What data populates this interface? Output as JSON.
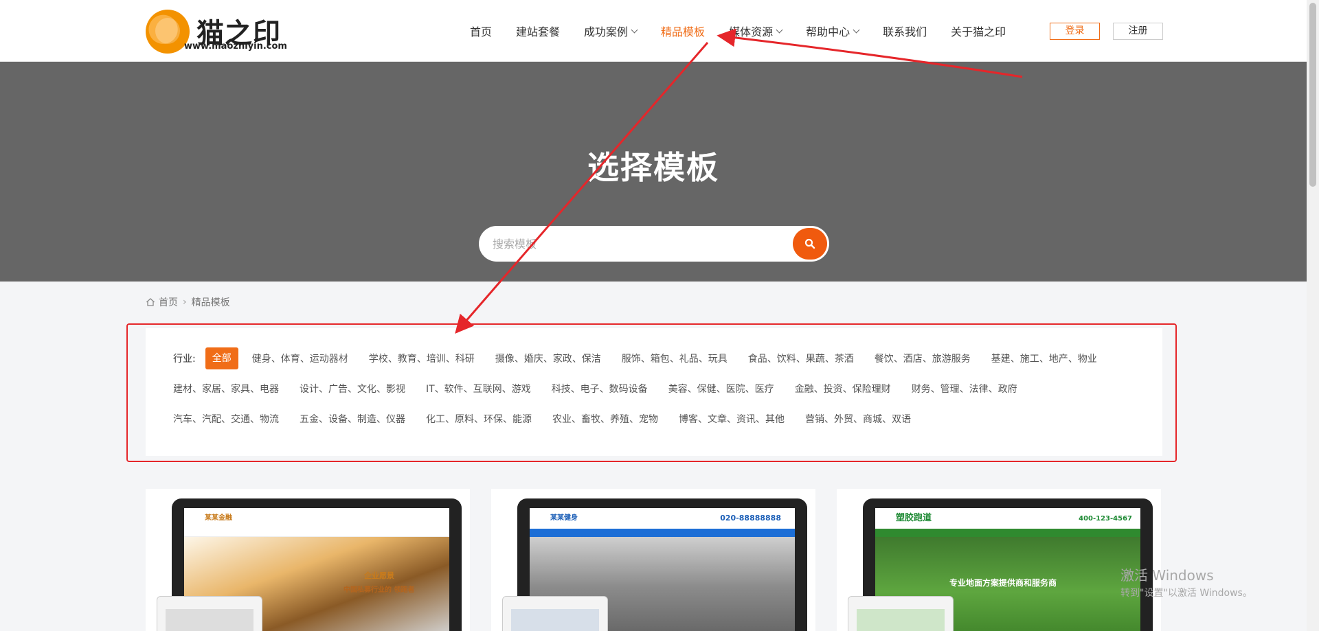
{
  "logo": {
    "name": "猫之印",
    "url": "www.maozhiyin.com"
  },
  "nav": {
    "items": [
      {
        "label": "首页",
        "dropdown": false,
        "active": false
      },
      {
        "label": "建站套餐",
        "dropdown": false,
        "active": false
      },
      {
        "label": "成功案例",
        "dropdown": true,
        "active": false
      },
      {
        "label": "精品模板",
        "dropdown": false,
        "active": true
      },
      {
        "label": "媒体资源",
        "dropdown": true,
        "active": false
      },
      {
        "label": "帮助中心",
        "dropdown": true,
        "active": false
      },
      {
        "label": "联系我们",
        "dropdown": false,
        "active": false
      },
      {
        "label": "关于猫之印",
        "dropdown": false,
        "active": false
      }
    ],
    "login_label": "登录",
    "register_label": "注册"
  },
  "hero": {
    "title": "选择模板",
    "search_placeholder": "搜索模板"
  },
  "breadcrumb": {
    "home": "首页",
    "current": "精品模板"
  },
  "filter": {
    "label": "行业:",
    "rows": [
      [
        "全部",
        "健身、体育、运动器材",
        "学校、教育、培训、科研",
        "摄像、婚庆、家政、保洁",
        "服饰、箱包、礼品、玩具",
        "食品、饮料、果蔬、茶酒",
        "餐饮、酒店、旅游服务",
        "基建、施工、地产、物业"
      ],
      [
        "建材、家居、家具、电器",
        "设计、广告、文化、影视",
        "IT、软件、互联网、游戏",
        "科技、电子、数码设备",
        "美容、保健、医院、医疗",
        "金融、投资、保险理财",
        "财务、管理、法律、政府"
      ],
      [
        "汽车、汽配、交通、物流",
        "五金、设备、制造、仪器",
        "化工、原料、环保、能源",
        "农业、畜牧、养殖、宠物",
        "博客、文章、资讯、其他",
        "营销、外贸、商城、双语"
      ]
    ],
    "active": "全部"
  },
  "cards": [
    {
      "brand": "某某金融",
      "caption1": "企业愿景",
      "caption2": "中国私募行业的 领跑者"
    },
    {
      "brand": "某某健身",
      "phone": "020-88888888"
    },
    {
      "brand": "塑胶跑道",
      "phone": "400-123-4567",
      "caption": "专业地面方案提供商和服务商"
    }
  ],
  "watermark": {
    "line1": "激活 Windows",
    "line2": "转到\"设置\"以激活 Windows。"
  },
  "colors": {
    "accent": "#f06d18",
    "hero_bg": "#666666",
    "highlight_red": "#e5262a"
  }
}
